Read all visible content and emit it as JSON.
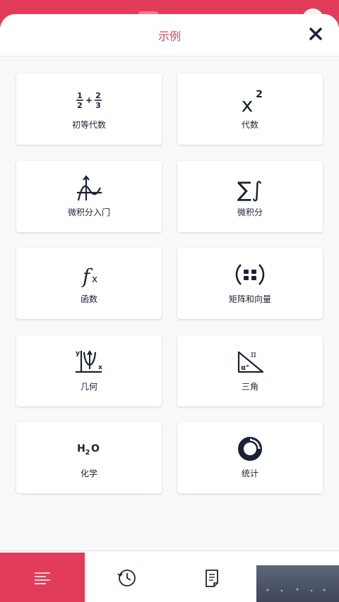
{
  "sheet": {
    "title": "示例"
  },
  "categories": [
    {
      "label": "初等代数",
      "icon": "fraction-icon"
    },
    {
      "label": "代数",
      "icon": "x-squared-icon"
    },
    {
      "label": "微积分入门",
      "icon": "curve-graph-icon"
    },
    {
      "label": "微积分",
      "icon": "sum-integral-icon"
    },
    {
      "label": "函数",
      "icon": "function-icon"
    },
    {
      "label": "矩阵和向量",
      "icon": "matrix-icon"
    },
    {
      "label": "几何",
      "icon": "parabola-axes-icon"
    },
    {
      "label": "三角",
      "icon": "triangle-angle-icon"
    },
    {
      "label": "化学",
      "icon": "h2o-icon"
    },
    {
      "label": "统计",
      "icon": "donut-chart-icon"
    }
  ],
  "icon_text": {
    "frac_top_a": "1",
    "frac_bot_a": "2",
    "frac_plus": "+",
    "frac_top_b": "2",
    "frac_bot_b": "3",
    "x_base": "x",
    "x_exp": "2",
    "sigma": "∑",
    "integral": "∫",
    "fx": "f",
    "fx_x": "x",
    "geo_y": "y",
    "geo_x": "x",
    "trig_pi": "π",
    "trig_alpha": "α°",
    "h2o_h": "H",
    "h2o_2": "2",
    "h2o_o": "O"
  },
  "bottom_nav": [
    {
      "name": "menu-list-icon",
      "active": true
    },
    {
      "name": "history-clock-icon",
      "active": false
    },
    {
      "name": "document-notes-icon",
      "active": false
    }
  ],
  "colors": {
    "accent": "#e23c5a",
    "ink": "#1a2233",
    "card": "#ffffff",
    "sheet_bg": "#f8f9fb"
  }
}
